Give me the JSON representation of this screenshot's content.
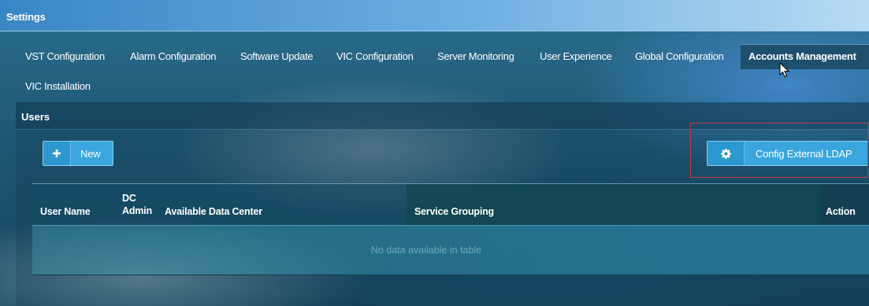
{
  "header": {
    "title": "Settings"
  },
  "tabs": [
    {
      "label": "VST Configuration"
    },
    {
      "label": "Alarm Configuration"
    },
    {
      "label": "Software Update"
    },
    {
      "label": "VIC Configuration"
    },
    {
      "label": "Server Monitoring"
    },
    {
      "label": "User Experience"
    },
    {
      "label": "Global Configuration"
    },
    {
      "label": "Accounts Management",
      "active": true
    },
    {
      "label": "VIC Installation"
    }
  ],
  "panel": {
    "title": "Users",
    "new_button": {
      "label": "New",
      "icon": "plus-icon"
    },
    "ldap_button": {
      "label": "Config External LDAP",
      "icon": "gear-icon"
    },
    "highlight_color": "#c0394b"
  },
  "table": {
    "columns": [
      {
        "label": "User Name"
      },
      {
        "label": "DC Admin",
        "lines": [
          "DC",
          "Admin"
        ]
      },
      {
        "label": "Available Data Center"
      },
      {
        "label": "Service Grouping"
      },
      {
        "label": "Action"
      }
    ],
    "empty_message": "No data available in table"
  },
  "colors": {
    "header_gradient_start": "#3a86c4",
    "button_accent": "#39a7dd",
    "active_tab": "#1e4f6d"
  }
}
